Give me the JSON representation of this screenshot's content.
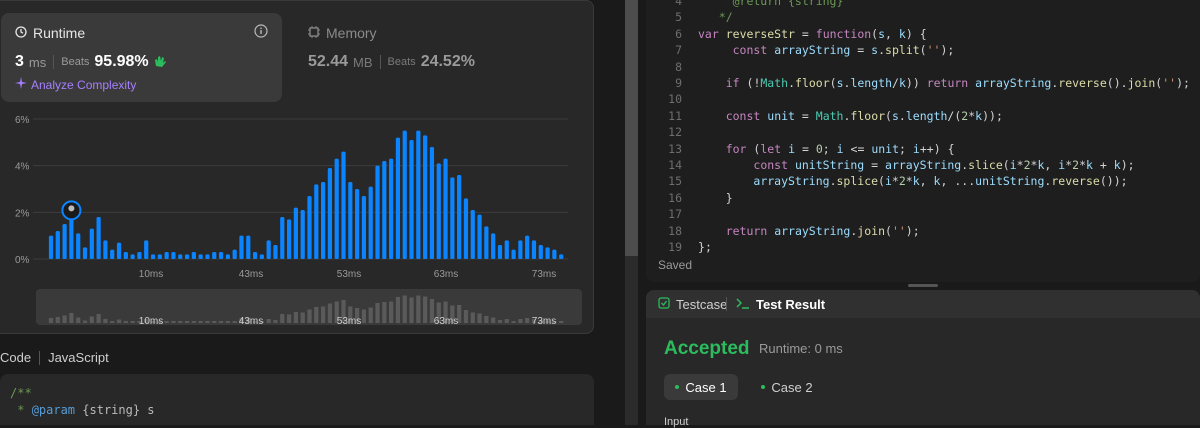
{
  "runtime": {
    "title": "Runtime",
    "value": "3",
    "unit": "ms",
    "beats_label": "Beats",
    "beats_value": "95.98%",
    "analyze_label": "Analyze Complexity"
  },
  "memory": {
    "title": "Memory",
    "value": "52.44",
    "unit": "MB",
    "beats_label": "Beats",
    "beats_value": "24.52%"
  },
  "chart_data": {
    "type": "bar",
    "y_ticks": [
      "6%",
      "4%",
      "2%",
      "0%"
    ],
    "x_ticks": [
      "10ms",
      "43ms",
      "53ms",
      "63ms",
      "73ms"
    ],
    "ylim": [
      0,
      6
    ],
    "values": [
      1.0,
      1.2,
      1.5,
      2.0,
      1.1,
      0.5,
      1.3,
      1.8,
      0.8,
      0.4,
      0.7,
      0.3,
      0.2,
      0.3,
      0.8,
      0.2,
      0.2,
      0.3,
      0.3,
      0.2,
      0.2,
      0.3,
      0.2,
      0.2,
      0.3,
      0.3,
      0.2,
      0.4,
      1.0,
      1.0,
      0.3,
      0.2,
      0.8,
      0.6,
      1.8,
      1.7,
      2.2,
      2.1,
      2.7,
      3.2,
      3.3,
      3.9,
      4.3,
      4.6,
      3.3,
      3.0,
      2.7,
      3.1,
      4.0,
      4.2,
      4.3,
      5.2,
      5.5,
      5.1,
      5.5,
      5.3,
      4.8,
      4.1,
      4.3,
      3.5,
      3.6,
      2.6,
      2.1,
      1.9,
      1.4,
      1.1,
      0.6,
      0.8,
      0.4,
      0.8,
      1.0,
      0.8,
      0.6,
      0.5,
      0.4,
      0.2
    ],
    "highlight_index": 3
  },
  "code_panel": {
    "tab_code": "Code",
    "tab_language": "JavaScript",
    "lines": [
      "/**",
      " * @param {string} s"
    ]
  },
  "editor": {
    "lines": [
      {
        "n": "4",
        "t": "     @return {string}"
      },
      {
        "n": "5",
        "t": "   */"
      },
      {
        "n": "6",
        "t": "var reverseStr = function(s, k) {"
      },
      {
        "n": "7",
        "t": "     const arrayString = s.split('');"
      },
      {
        "n": "8",
        "t": ""
      },
      {
        "n": "9",
        "t": "    if (!Math.floor(s.length/k)) return arrayString.reverse().join('');"
      },
      {
        "n": "10",
        "t": ""
      },
      {
        "n": "11",
        "t": "    const unit = Math.floor(s.length/(2*k));"
      },
      {
        "n": "12",
        "t": ""
      },
      {
        "n": "13",
        "t": "    for (let i = 0; i <= unit; i++) {"
      },
      {
        "n": "14",
        "t": "        const unitString = arrayString.slice(i*2*k, i*2*k + k);"
      },
      {
        "n": "15",
        "t": "        arrayString.splice(i*2*k, k, ...unitString.reverse());"
      },
      {
        "n": "16",
        "t": "    }"
      },
      {
        "n": "17",
        "t": ""
      },
      {
        "n": "18",
        "t": "    return arrayString.join('');"
      },
      {
        "n": "19",
        "t": "};"
      }
    ],
    "saved": "Saved"
  },
  "result": {
    "tab_testcase": "Testcase",
    "tab_result": "Test Result",
    "status": "Accepted",
    "runtime": "Runtime: 0 ms",
    "case1": "Case 1",
    "case2": "Case 2",
    "input_label": "Input"
  },
  "colors": {
    "accent_green": "#2cbb5d",
    "bar_blue": "#0a84ff",
    "purple": "#a67fff"
  }
}
